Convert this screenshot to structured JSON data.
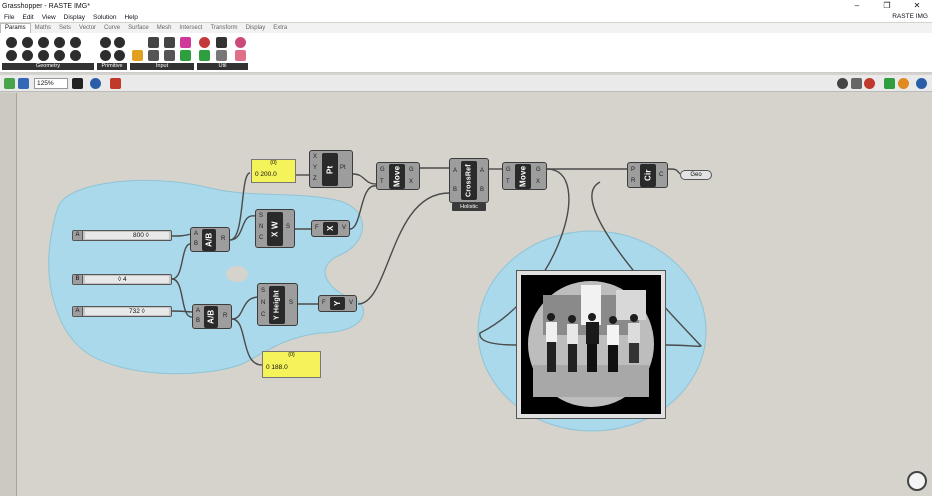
{
  "window": {
    "title": "Grasshopper - RASTE IMG*",
    "doc_name": "RASTE IMG",
    "controls": [
      "–",
      "❐",
      "✕"
    ]
  },
  "menu": [
    "File",
    "Edit",
    "View",
    "Display",
    "Solution",
    "Help"
  ],
  "tabs": [
    "Params",
    "Maths",
    "Sets",
    "Vector",
    "Curve",
    "Surface",
    "Mesh",
    "Intersect",
    "Transform",
    "Display",
    "Extra"
  ],
  "active_tab": "Params",
  "ribbon_groups": [
    "Geometry",
    "Primitive",
    "Input",
    "Util"
  ],
  "toolbar": {
    "zoom": "125%"
  },
  "sliders": [
    {
      "label": "A",
      "value": "800 ◊"
    },
    {
      "label": "B",
      "value": "◊ 4"
    },
    {
      "label": "A",
      "value": "732 ◊"
    }
  ],
  "panels": [
    {
      "header": "{0}",
      "text": "0 200.0"
    },
    {
      "header": "{0}",
      "text": "0 188.0"
    }
  ],
  "components": {
    "div1": {
      "name": "A/B",
      "inputs": [
        "A",
        "B"
      ],
      "outputs": [
        "R"
      ]
    },
    "div2": {
      "name": "A/B",
      "inputs": [
        "A",
        "B"
      ],
      "outputs": [
        "R"
      ]
    },
    "xw": {
      "name": "X W",
      "inputs": [
        "S",
        "N",
        "C"
      ],
      "outputs": [
        "S"
      ]
    },
    "yheight": {
      "name": "Y Height",
      "inputs": [
        "S",
        "N",
        "C"
      ],
      "outputs": [
        "S"
      ]
    },
    "x": {
      "name": "X",
      "inputs": [
        "F"
      ],
      "outputs": [
        "V"
      ]
    },
    "y": {
      "name": "Y",
      "inputs": [
        "F"
      ],
      "outputs": [
        "V"
      ]
    },
    "pt": {
      "name": "Pt",
      "inputs": [
        "X",
        "Y",
        "Z"
      ],
      "outputs": [
        "Pt"
      ]
    },
    "move1": {
      "name": "Move",
      "inputs": [
        "G",
        "T"
      ],
      "outputs": [
        "G",
        "X"
      ]
    },
    "crossref": {
      "name": "CrossRef",
      "inputs": [
        "A",
        "B"
      ],
      "outputs": [
        "A",
        "B"
      ],
      "mode": "Holistic"
    },
    "move2": {
      "name": "Move",
      "inputs": [
        "G",
        "T"
      ],
      "outputs": [
        "G",
        "X"
      ]
    },
    "cir": {
      "name": "Cir",
      "inputs": [
        "P",
        "R"
      ],
      "outputs": [
        "C"
      ]
    }
  },
  "geo_param": {
    "label": "Geo"
  },
  "colors": {
    "canvas": "#d6d3cc",
    "group": "#a8d8ea",
    "panel": "#f4f35a",
    "component": "#9d9d9d",
    "component_body": "#2a2a2a"
  }
}
